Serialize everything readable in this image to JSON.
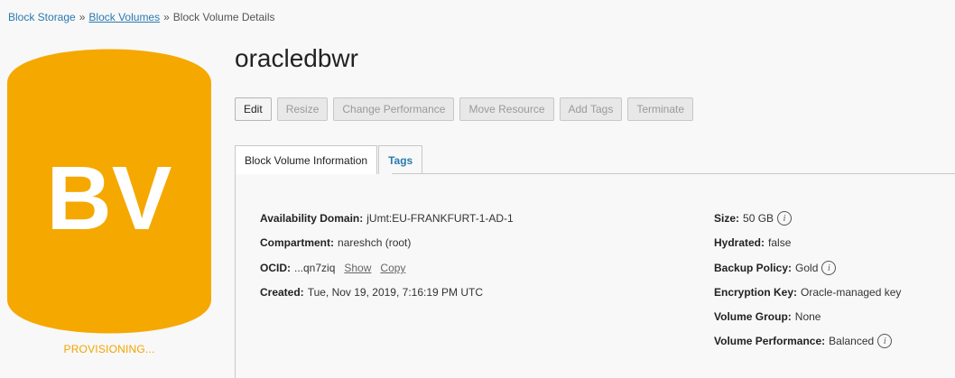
{
  "breadcrumb": {
    "items": [
      {
        "label": "Block Storage"
      },
      {
        "label": "Block Volumes"
      }
    ],
    "separator": "»",
    "current": "Block Volume Details"
  },
  "avatar": {
    "initials": "BV",
    "color": "#f5a800",
    "status": "PROVISIONING..."
  },
  "title": "oracledbwr",
  "actions": {
    "edit": "Edit",
    "resize": "Resize",
    "change_performance": "Change Performance",
    "move_resource": "Move Resource",
    "add_tags": "Add Tags",
    "terminate": "Terminate"
  },
  "tabs": {
    "info": "Block Volume Information",
    "tags": "Tags"
  },
  "info": {
    "availability_domain": {
      "label": "Availability Domain:",
      "value": "jUmt:EU-FRANKFURT-1-AD-1"
    },
    "compartment": {
      "label": "Compartment:",
      "value": "nareshch (root)"
    },
    "ocid": {
      "label": "OCID:",
      "value": "...qn7ziq",
      "show": "Show",
      "copy": "Copy"
    },
    "created": {
      "label": "Created:",
      "value": "Tue, Nov 19, 2019, 7:16:19 PM UTC"
    },
    "size": {
      "label": "Size:",
      "value": "50 GB"
    },
    "hydrated": {
      "label": "Hydrated:",
      "value": "false"
    },
    "backup_policy": {
      "label": "Backup Policy:",
      "value": "Gold"
    },
    "encryption_key": {
      "label": "Encryption Key:",
      "value": "Oracle-managed key"
    },
    "volume_group": {
      "label": "Volume Group:",
      "value": "None"
    },
    "volume_performance": {
      "label": "Volume Performance:",
      "value": "Balanced"
    }
  },
  "icons": {
    "info": "info-icon"
  }
}
